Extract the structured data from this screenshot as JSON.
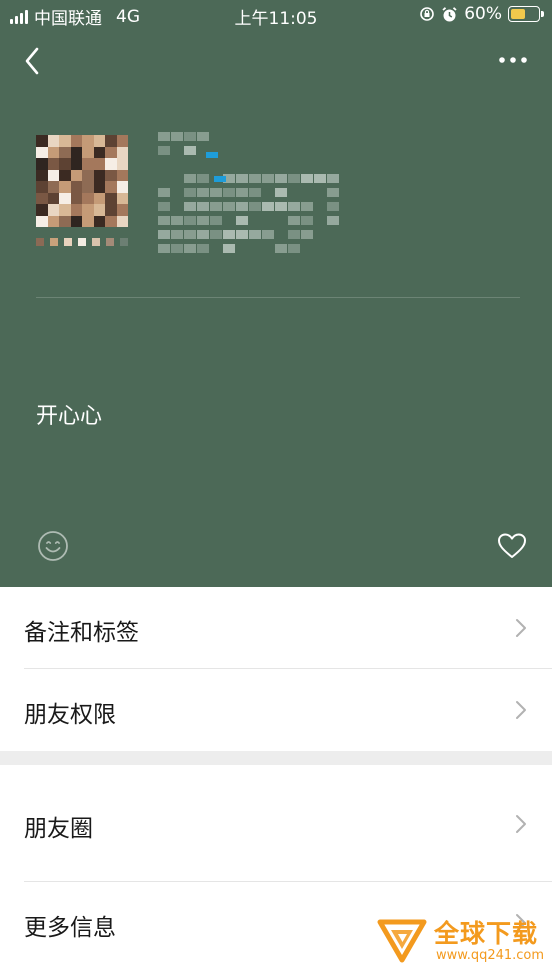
{
  "status_bar": {
    "carrier": "中国联通",
    "network": "4G",
    "time": "上午11:05",
    "battery": "60%",
    "battery_level": 0.6
  },
  "nav": {
    "back_icon": "chevron-left-icon",
    "more_icon": "more-dots-icon"
  },
  "profile": {
    "status_text": "开心心",
    "smiley_icon": "smiley-icon",
    "like_icon": "heart-icon"
  },
  "menu": {
    "group1": [
      {
        "label": "备注和标签"
      },
      {
        "label": "朋友权限"
      }
    ],
    "group2": [
      {
        "label": "朋友圈"
      },
      {
        "label": "更多信息"
      }
    ]
  },
  "watermark": {
    "title": "全球下载",
    "url": "www.qq241.com"
  },
  "colors": {
    "header_bg": "#4c6957",
    "page_bg": "#ededed",
    "watermark": "#f39a1e",
    "battery": "#f2c94c",
    "chevron": "#b2b2b2"
  }
}
